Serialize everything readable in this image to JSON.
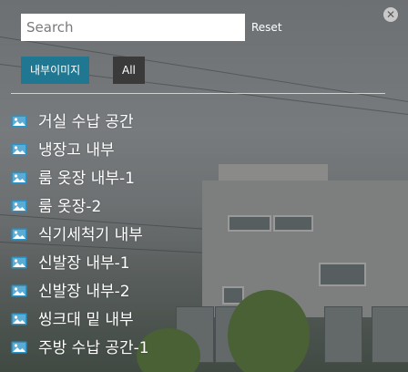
{
  "search": {
    "placeholder": "Search",
    "value": ""
  },
  "reset_label": "Reset",
  "close_symbol": "✕",
  "filters": [
    {
      "label": "내부이미지",
      "active": true
    },
    {
      "label": "All",
      "active": false
    }
  ],
  "items": [
    {
      "label": "거실 수납 공간",
      "icon": "image-icon"
    },
    {
      "label": "냉장고 내부",
      "icon": "image-icon"
    },
    {
      "label": "룸 옷장 내부-1",
      "icon": "image-icon"
    },
    {
      "label": "룸 옷장-2",
      "icon": "image-icon"
    },
    {
      "label": "식기세척기 내부",
      "icon": "image-icon"
    },
    {
      "label": "신발장 내부-1",
      "icon": "image-icon"
    },
    {
      "label": "신발장 내부-2",
      "icon": "image-icon"
    },
    {
      "label": "씽크대 밑 내부",
      "icon": "image-icon"
    },
    {
      "label": "주방 수납 공간-1",
      "icon": "image-icon"
    }
  ],
  "colors": {
    "accent": "#1f7791",
    "icon": "#2a93c7",
    "secondary_button": "#3a3a3a",
    "text": "#ffffff"
  }
}
